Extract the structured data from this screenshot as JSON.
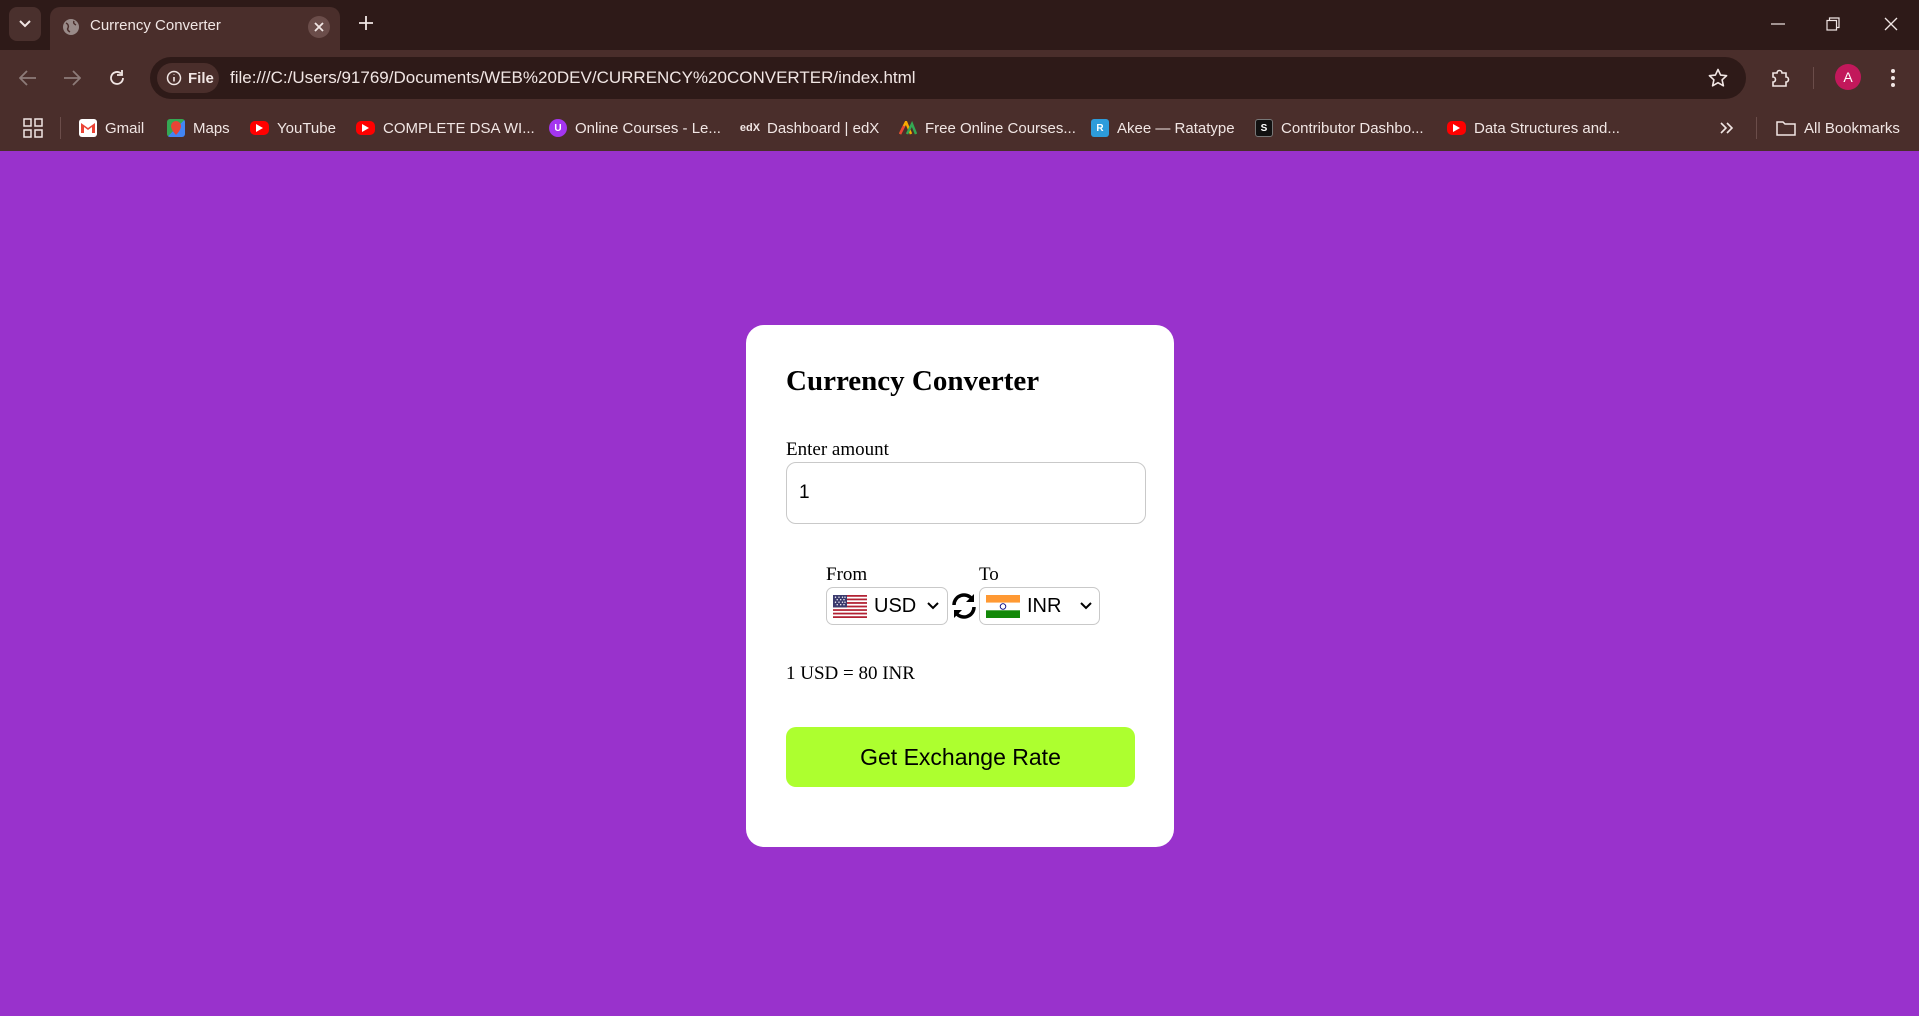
{
  "browser": {
    "tab_title": "Currency Converter",
    "chip_label": "File",
    "url": "file:///C:/Users/91769/Documents/WEB%20DEV/CURRENCY%20CONVERTER/index.html",
    "avatar_letter": "A",
    "all_bookmarks": "All Bookmarks",
    "bookmarks": [
      {
        "label": "Gmail",
        "icon": "gmail-icon"
      },
      {
        "label": "Maps",
        "icon": "maps-icon"
      },
      {
        "label": "YouTube",
        "icon": "youtube-icon"
      },
      {
        "label": "COMPLETE DSA WI...",
        "icon": "youtube-icon"
      },
      {
        "label": "Online Courses - Le...",
        "icon": "udemy-icon"
      },
      {
        "label": "Dashboard | edX",
        "icon": "edx-icon"
      },
      {
        "label": "Free Online Courses...",
        "icon": "coursera-icon"
      },
      {
        "label": "Akee — Ratatype",
        "icon": "ratatype-icon"
      },
      {
        "label": "Contributor Dashbo...",
        "icon": "contributor-icon"
      },
      {
        "label": "Data Structures and...",
        "icon": "youtube-icon"
      }
    ]
  },
  "app": {
    "title": "Currency Converter",
    "amount_label": "Enter amount",
    "amount_value": "1",
    "from_label": "From",
    "to_label": "To",
    "from_currency": "USD",
    "to_currency": "INR",
    "result": "1 USD = 80 INR",
    "button_label": "Get Exchange Rate",
    "colors": {
      "background": "#9932cc",
      "button": "#adff2f",
      "card": "#ffffff"
    }
  }
}
